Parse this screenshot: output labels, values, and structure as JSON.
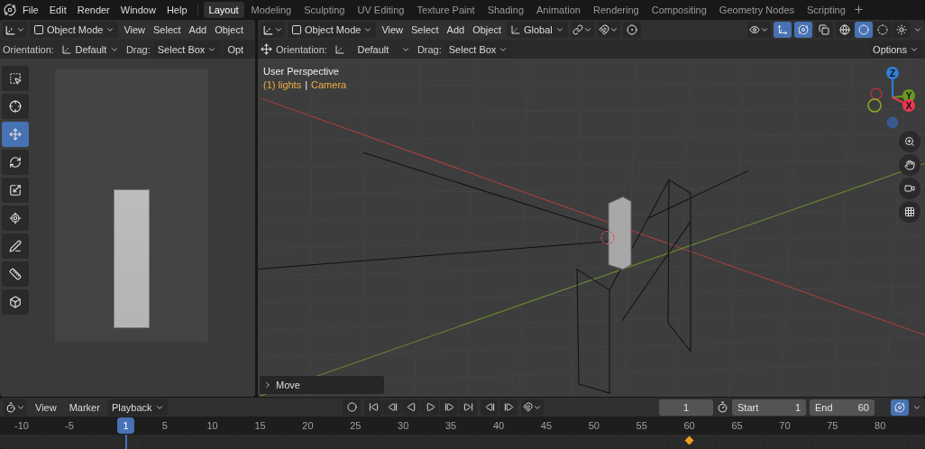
{
  "menu": [
    "File",
    "Edit",
    "Render",
    "Window",
    "Help"
  ],
  "workspaces": [
    {
      "label": "Layout",
      "selected": true
    },
    {
      "label": "Modeling",
      "selected": false
    },
    {
      "label": "Sculpting",
      "selected": false
    },
    {
      "label": "UV Editing",
      "selected": false
    },
    {
      "label": "Texture Paint",
      "selected": false
    },
    {
      "label": "Shading",
      "selected": false
    },
    {
      "label": "Animation",
      "selected": false
    },
    {
      "label": "Rendering",
      "selected": false
    },
    {
      "label": "Compositing",
      "selected": false
    },
    {
      "label": "Geometry Nodes",
      "selected": false
    },
    {
      "label": "Scripting",
      "selected": false
    }
  ],
  "camera_view": {
    "header": {
      "mode": "Object Mode",
      "menus": [
        "View",
        "Select",
        "Add",
        "Object"
      ]
    },
    "tool_settings": {
      "orientation_label": "Orientation:",
      "orientation": "Default",
      "drag_label": "Drag:",
      "drag": "Select Box",
      "options": "Opt"
    },
    "tools": [
      {
        "kind": "select",
        "selected": false
      },
      {
        "kind": "cursor",
        "selected": false
      },
      {
        "kind": "move",
        "selected": true
      },
      {
        "kind": "rotate",
        "selected": false
      },
      {
        "kind": "scale",
        "selected": false
      },
      {
        "kind": "transform",
        "selected": false
      },
      {
        "kind": "annotate",
        "selected": false
      },
      {
        "kind": "measure",
        "selected": false
      },
      {
        "kind": "add_cube",
        "selected": false
      }
    ]
  },
  "viewport": {
    "header": {
      "mode": "Object Mode",
      "menus": [
        "View",
        "Select",
        "Add",
        "Object"
      ],
      "orientation": "Global",
      "toggles": [
        {
          "kind": "gizmo",
          "on": true
        },
        {
          "kind": "overlays",
          "on": true
        },
        {
          "kind": "xray",
          "on": false
        }
      ],
      "shading": [
        {
          "kind": "wireframe",
          "selected": false
        },
        {
          "kind": "solid",
          "selected": true
        },
        {
          "kind": "material",
          "selected": false
        },
        {
          "kind": "rendered",
          "selected": false
        }
      ]
    },
    "tool_settings": {
      "orientation_label": "Orientation:",
      "orientation": "Default",
      "drag_label": "Drag:",
      "drag": "Select Box",
      "options": "Options"
    },
    "view_name": "User Perspective",
    "collection": "(1) lights",
    "separator": "|",
    "active_object": "Camera",
    "axes": [
      {
        "label": "Z",
        "color": "#2f7fd8"
      },
      {
        "label": "Y",
        "color": "#6a9a1f"
      },
      {
        "label": "X",
        "color": "#e8384f"
      }
    ],
    "last_operator": "Move"
  },
  "timeline": {
    "menus": [
      {
        "label": "View",
        "kind": "menu"
      },
      {
        "label": "Marker",
        "kind": "menu"
      },
      {
        "label": "Playback",
        "kind": "dropdown"
      }
    ],
    "auto_keying": false,
    "current_frame": "1",
    "start_label": "Start",
    "start": "1",
    "end_label": "End",
    "end": "60",
    "overlay_on": true,
    "ticks": [
      "-10",
      "-5",
      "5",
      "10",
      "15",
      "20",
      "25",
      "30",
      "35",
      "40",
      "45",
      "50",
      "55",
      "60",
      "65",
      "70",
      "75",
      "80"
    ],
    "playhead": "1"
  }
}
